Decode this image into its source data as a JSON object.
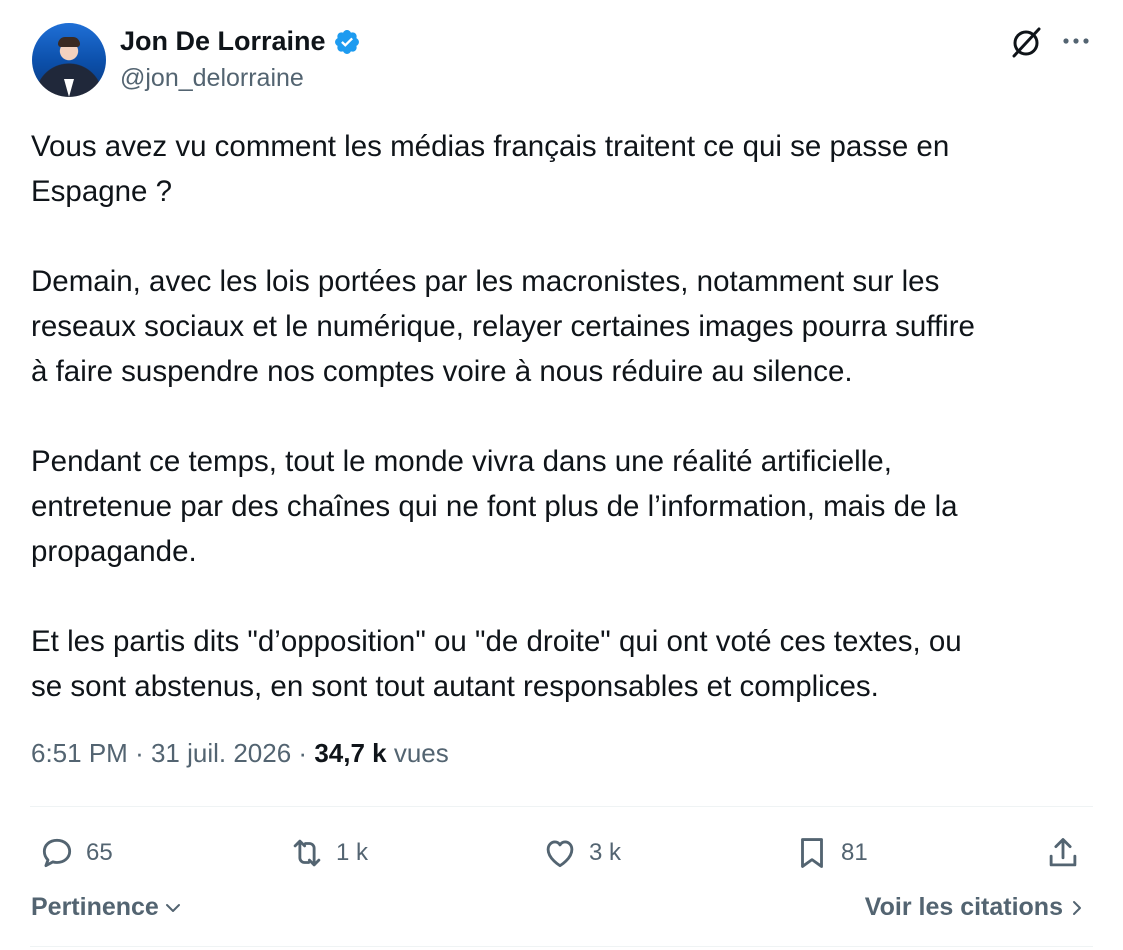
{
  "author": {
    "name": "Jon De Lorraine",
    "handle": "@jon_delorraine",
    "verified": true
  },
  "tweet": {
    "text": "Vous avez vu comment les médias français traitent ce qui se passe en\nEspagne ?\n\nDemain, avec les lois portées par les macronistes, notamment sur les\nreseaux sociaux et le numérique, relayer certaines images pourra suffire\nà faire suspendre nos comptes voire à nous réduire au silence.\n\nPendant ce temps, tout le monde vivra dans une réalité artificielle,\nentretenue par des chaînes qui ne font plus de l’information, mais de la\npropagande.\n\nEt les partis dits \"d’opposition\" ou \"de droite\" qui ont voté ces textes, ou\nse sont abstenus, en sont tout autant responsables et complices.",
    "time": "6:51 PM",
    "date": "31 juil. 2026",
    "views_count": "34,7 k",
    "views_label": "vues"
  },
  "actions": {
    "replies": "65",
    "reposts": "1 k",
    "likes": "3 k",
    "bookmarks": "81"
  },
  "footer": {
    "sort_label": "Pertinence",
    "quotes_label": "Voir les citations"
  },
  "colors": {
    "accent": "#1d9bf0",
    "secondary_text": "#536471",
    "primary_text": "#0f1419",
    "divider": "#eff3f4"
  },
  "icons": [
    "verified-badge-icon",
    "grok-icon",
    "more-icon",
    "reply-icon",
    "repost-icon",
    "like-icon",
    "bookmark-icon",
    "share-icon",
    "chevron-down-icon",
    "chevron-right-icon"
  ]
}
